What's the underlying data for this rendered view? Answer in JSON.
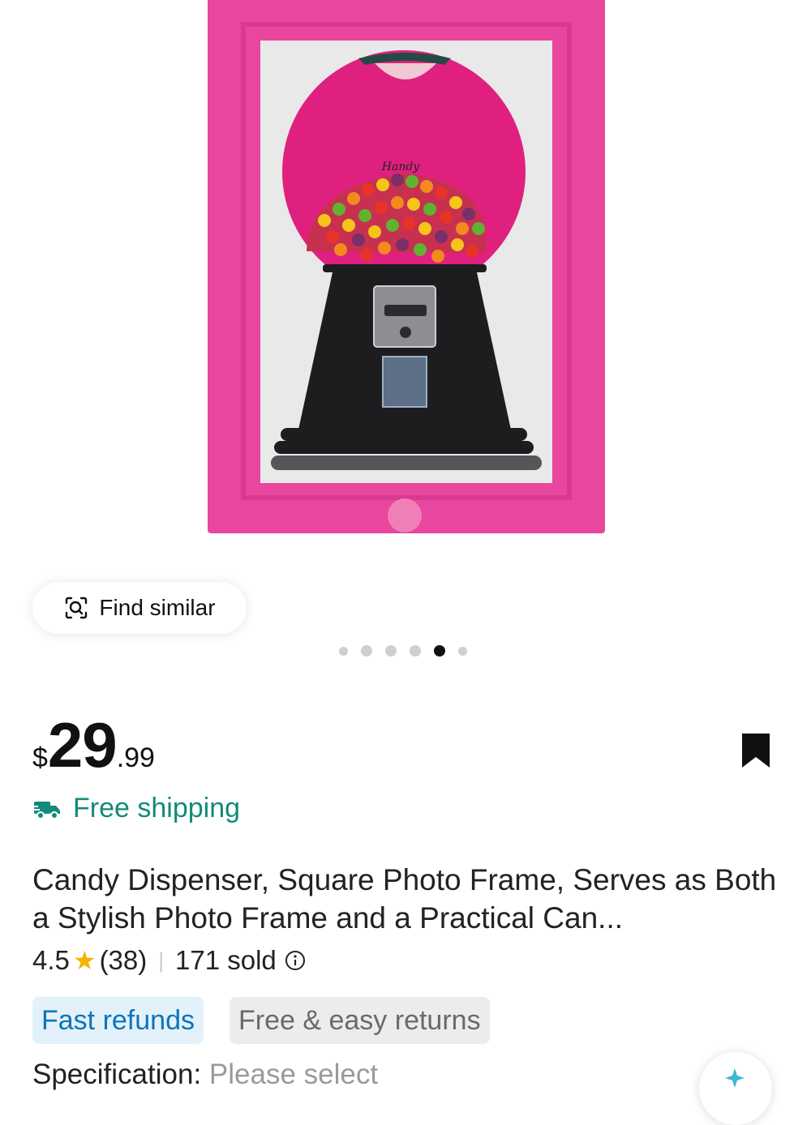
{
  "image": {
    "carousel": {
      "dot_count": 6,
      "active_index": 4
    },
    "find_similar_label": "Find similar",
    "brand_mark": "Handy"
  },
  "price": {
    "currency": "$",
    "whole": "29",
    "cents": ".99"
  },
  "shipping": {
    "label": "Free shipping"
  },
  "title": "Candy Dispenser, Square Photo Frame, Serves as Both a Stylish Photo Frame and a Practical Can...",
  "rating": {
    "score": "4.5",
    "count": "(38)",
    "sold": "171 sold"
  },
  "badges": {
    "fast_refunds": "Fast refunds",
    "returns": "Free & easy returns"
  },
  "specification": {
    "label": "Specification:",
    "value": "Please select"
  },
  "colors": {
    "frame_pink": "#e8469f",
    "globe_magenta": "#e0207f",
    "base_black": "#1d1d1f",
    "shipping_green": "#128a7c",
    "fast_refunds_blue": "#0d75b8",
    "star": "#f5b400"
  },
  "icons": [
    "scan-search-icon",
    "bookmark-icon",
    "delivery-truck-icon",
    "star-icon",
    "info-icon",
    "sparkle-icon"
  ]
}
